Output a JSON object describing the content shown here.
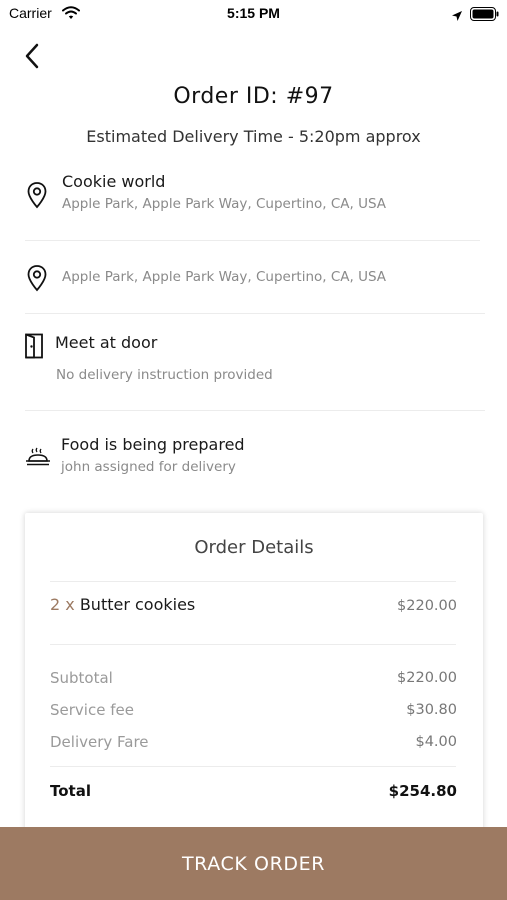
{
  "status_bar": {
    "carrier": "Carrier",
    "time": "5:15 PM"
  },
  "header": {
    "back_icon": "chevron-left-icon",
    "order_id": "Order ID: #97",
    "eta": "Estimated Delivery Time - 5:20pm approx"
  },
  "pickup": {
    "icon": "location-pin-icon",
    "name": "Cookie world",
    "address": "Apple Park, Apple Park Way, Cupertino, CA, USA"
  },
  "dropoff": {
    "icon": "location-pin-icon",
    "address": "Apple Park, Apple Park Way, Cupertino, CA, USA"
  },
  "instructions": {
    "icon": "door-icon",
    "title": "Meet at door",
    "subtitle": "No delivery instruction provided"
  },
  "status": {
    "icon": "food-tray-icon",
    "title": "Food is being prepared",
    "subtitle": "john assigned for delivery"
  },
  "order_details": {
    "title": "Order Details",
    "items": [
      {
        "qty": "2 x",
        "name": "Butter cookies",
        "price": "$220.00"
      }
    ],
    "subtotal_label": "Subtotal",
    "subtotal_value": "$220.00",
    "service_fee_label": "Service fee",
    "service_fee_value": "$30.80",
    "delivery_fare_label": "Delivery Fare",
    "delivery_fare_value": "$4.00",
    "total_label": "Total",
    "total_value": "$254.80"
  },
  "track_button": "TRACK ORDER",
  "colors": {
    "accent": "#9d7a62",
    "muted_text": "#8a8a8a"
  }
}
